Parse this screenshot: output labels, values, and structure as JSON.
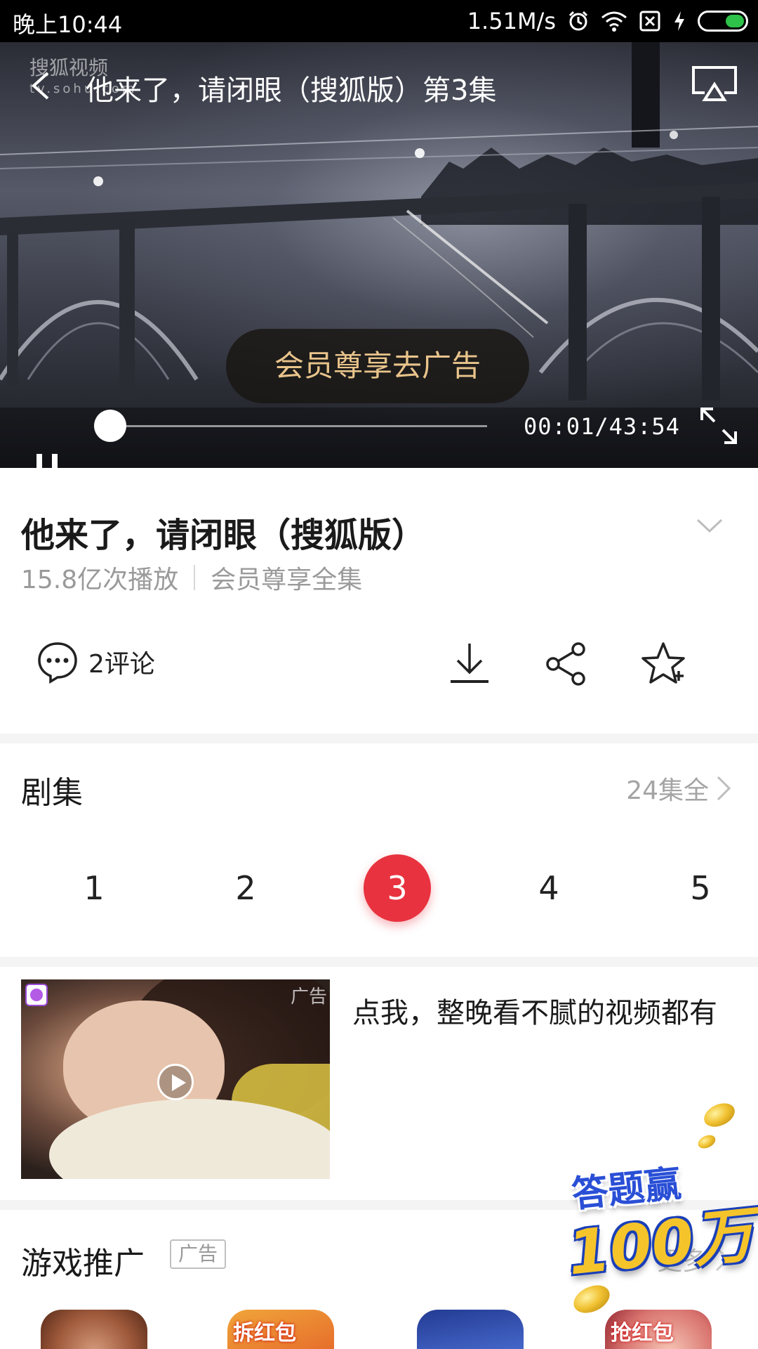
{
  "status_bar": {
    "time": "晚上10:44",
    "network_speed": "1.51M/s",
    "battery_color": "#2ec24a"
  },
  "player": {
    "watermark_line1": "搜狐视频",
    "watermark_line2": "tv.sohu.com",
    "title": "他来了，请闭眼（搜狐版）第3集",
    "vip_ad_label": "会员尊享去广告",
    "progress_fraction": 0.0004,
    "time_readout": "00:01/43:54",
    "accent_color": "#e9c48b"
  },
  "show": {
    "title": "他来了，请闭眼（搜狐版）",
    "play_count": "15.8亿次播放",
    "vip_note": "会员尊享全集"
  },
  "actions": {
    "comments_label": "2评论",
    "icons": [
      "comment-icon",
      "download-icon",
      "share-icon",
      "favorite-add-icon"
    ]
  },
  "episodes": {
    "header": "剧集",
    "more_label": "24集全",
    "items": [
      "1",
      "2",
      "3",
      "4",
      "5"
    ],
    "active_index": 2,
    "active_color": "#e8323f"
  },
  "ad_card": {
    "corner_tag": "广告",
    "text": "点我，整晚看不腻的视频都有"
  },
  "games": {
    "header": "游戏推广",
    "ad_badge": "广告",
    "more_label": "更多",
    "items": [
      {
        "label": ""
      },
      {
        "label": "拆红包"
      },
      {
        "label": ""
      },
      {
        "label": "抢红包"
      }
    ]
  },
  "promo": {
    "line1": "答题赢",
    "line2": "100万"
  }
}
